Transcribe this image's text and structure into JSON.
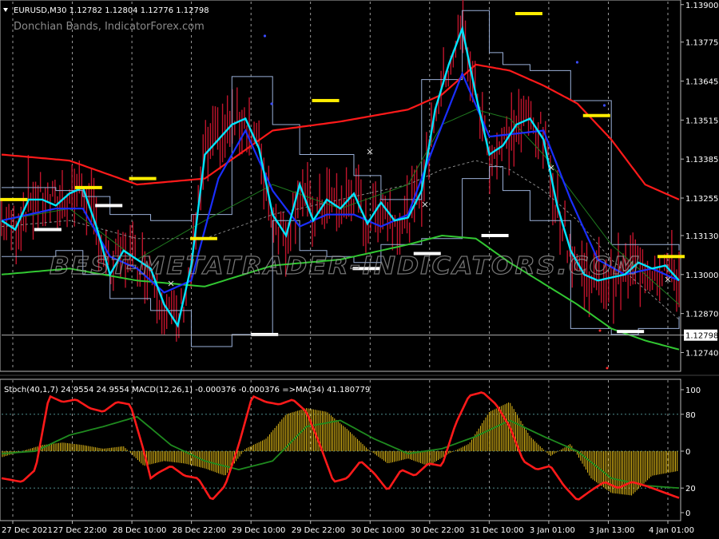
{
  "header": {
    "symbol_line": "EURUSD,M30  1.12782 1.12804 1.12776 1.12798",
    "indicator_name": "Donchian Bands, IndicatorForex.com"
  },
  "watermark": "BEST-METATRADER-INDICATORS.COM",
  "sub_header": "Stoch(40,1,7) 24.9554 24.9554  MACD(12,26,1) -0.000376 -0.000376  =>MA(34) 41.180779",
  "colors": {
    "background": "#000000",
    "candles": "#c0142c",
    "donchian": "#9ab0d8",
    "ma_red": "#ff1a1a",
    "ma_green": "#32c832",
    "ma_darkgreen": "#1f7a1f",
    "ma_gray": "#8c8c8c",
    "fast_cyan": "#00e5ff",
    "slow_blue": "#1a2fff",
    "highs": "#ffee00",
    "lows": "#ffffff",
    "stoch": "#ff1a1a",
    "signal": "#1f8a1f",
    "macd_hist": "#ffd21a",
    "price_marker": "#ffffff"
  },
  "chart_data": [
    {
      "type": "line",
      "symbol": "EURUSD",
      "timeframe": "M30",
      "x_ticks": [
        "27 Dec 2021",
        "27 Dec 22:00",
        "28 Dec 10:00",
        "28 Dec 22:00",
        "29 Dec 10:00",
        "29 Dec 22:00",
        "30 Dec 10:00",
        "30 Dec 22:00",
        "31 Dec 10:00",
        "3 Jan 01:00",
        "3 Jan 13:00",
        "4 Jan 01:00"
      ],
      "y_ticks": [
        "1.13900",
        "1.13775",
        "1.13645",
        "1.13515",
        "1.13385",
        "1.13255",
        "1.13130",
        "1.13000",
        "1.12870",
        "1.12798",
        "1.12740"
      ],
      "ylim": [
        1.1268,
        1.1391
      ],
      "current_price": "1.12798",
      "grid": "dashed vertical",
      "series": [
        {
          "key": "fast_ma",
          "t": [
            0,
            2,
            4,
            6,
            8,
            10,
            12,
            14,
            16,
            18,
            20,
            22,
            24,
            26,
            28,
            30,
            32,
            34,
            36,
            38,
            40,
            42,
            44,
            46,
            48,
            50,
            52,
            54,
            56,
            58,
            60,
            62,
            64,
            66,
            68,
            70,
            72,
            74,
            76,
            78,
            80,
            82,
            84,
            86,
            88,
            90,
            92,
            94,
            96,
            98,
            100
          ],
          "values": [
            1.1318,
            1.1315,
            1.1325,
            1.1325,
            1.1323,
            1.1327,
            1.1329,
            1.1316,
            1.13,
            1.1308,
            1.1305,
            1.1302,
            1.129,
            1.1283,
            1.1303,
            1.134,
            1.1345,
            1.135,
            1.1352,
            1.1342,
            1.132,
            1.1313,
            1.133,
            1.1318,
            1.1325,
            1.1322,
            1.1327,
            1.1317,
            1.1324,
            1.1318,
            1.1319,
            1.1328,
            1.1355,
            1.137,
            1.1382,
            1.136,
            1.134,
            1.1343,
            1.135,
            1.1352,
            1.1345,
            1.1323,
            1.1308,
            1.13,
            1.1298,
            1.1299,
            1.13,
            1.1304,
            1.1302,
            1.1303,
            1.1298
          ]
        },
        {
          "key": "slow_ma",
          "t": [
            0,
            4,
            8,
            12,
            16,
            20,
            24,
            28,
            32,
            36,
            40,
            44,
            48,
            52,
            56,
            60,
            64,
            68,
            72,
            76,
            80,
            84,
            88,
            92,
            96,
            100
          ],
          "values": [
            1.1318,
            1.132,
            1.1322,
            1.1322,
            1.1306,
            1.1302,
            1.1294,
            1.1298,
            1.1332,
            1.1348,
            1.1328,
            1.1316,
            1.132,
            1.132,
            1.1316,
            1.132,
            1.1344,
            1.1367,
            1.1346,
            1.1347,
            1.1348,
            1.1325,
            1.1305,
            1.13,
            1.1302,
            1.1298
          ]
        },
        {
          "key": "red_ma",
          "t": [
            0,
            10,
            20,
            30,
            40,
            50,
            60,
            65,
            70,
            75,
            80,
            85,
            90,
            95,
            100
          ],
          "values": [
            1.134,
            1.1338,
            1.133,
            1.1332,
            1.1348,
            1.1351,
            1.1355,
            1.136,
            1.137,
            1.1368,
            1.1363,
            1.1357,
            1.1345,
            1.133,
            1.1325
          ]
        },
        {
          "key": "gray_ma",
          "t": [
            0,
            10,
            20,
            30,
            40,
            50,
            60,
            65,
            70,
            75,
            80,
            85,
            90,
            95,
            100
          ],
          "values": [
            1.1316,
            1.1318,
            1.1312,
            1.1312,
            1.132,
            1.1325,
            1.133,
            1.1335,
            1.1338,
            1.1335,
            1.1328,
            1.1318,
            1.1305,
            1.1295,
            1.1285
          ]
        },
        {
          "key": "darkgreen_ma",
          "t": [
            0,
            10,
            20,
            30,
            40,
            50,
            60,
            65,
            70,
            75,
            80,
            85,
            90,
            95,
            100
          ],
          "values": [
            1.1318,
            1.1322,
            1.1305,
            1.1318,
            1.133,
            1.1322,
            1.133,
            1.135,
            1.1355,
            1.1352,
            1.134,
            1.1325,
            1.131,
            1.13,
            1.129
          ]
        },
        {
          "key": "green_ma",
          "t": [
            0,
            10,
            20,
            30,
            40,
            50,
            60,
            65,
            70,
            75,
            80,
            85,
            90,
            95,
            100
          ],
          "values": [
            1.13,
            1.1302,
            1.1298,
            1.1296,
            1.1303,
            1.1305,
            1.131,
            1.1313,
            1.1312,
            1.1304,
            1.1297,
            1.129,
            1.1282,
            1.1278,
            1.1275
          ]
        }
      ],
      "donchian_upper": {
        "t": [
          0,
          8,
          12,
          16,
          22,
          28,
          34,
          40,
          44,
          48,
          52,
          56,
          62,
          68,
          72,
          74,
          78,
          84,
          90,
          94,
          100
        ],
        "values": [
          1.1329,
          1.1328,
          1.1326,
          1.132,
          1.1318,
          1.132,
          1.1366,
          1.135,
          1.134,
          1.134,
          1.1333,
          1.1325,
          1.1365,
          1.1388,
          1.1374,
          1.137,
          1.1368,
          1.1358,
          1.131,
          1.131,
          1.1308
        ]
      },
      "donchian_lower": {
        "t": [
          0,
          8,
          12,
          16,
          22,
          28,
          34,
          40,
          44,
          48,
          52,
          56,
          62,
          68,
          72,
          74,
          78,
          84,
          90,
          94,
          100
        ],
        "values": [
          1.1306,
          1.1308,
          1.13,
          1.1292,
          1.1288,
          1.1276,
          1.128,
          1.1318,
          1.1308,
          1.1306,
          1.1304,
          1.131,
          1.1312,
          1.1332,
          1.1336,
          1.1328,
          1.1318,
          1.1282,
          1.128,
          1.1282,
          1.1286
        ]
      },
      "high_markers": [
        {
          "t": 1,
          "y": 1.1325
        },
        {
          "t": 12,
          "y": 1.1329
        },
        {
          "t": 20,
          "y": 1.1332
        },
        {
          "t": 29,
          "y": 1.1312
        },
        {
          "t": 47,
          "y": 1.1358
        },
        {
          "t": 77,
          "y": 1.1387
        },
        {
          "t": 87,
          "y": 1.1353
        },
        {
          "t": 98,
          "y": 1.1306
        }
      ],
      "low_markers": [
        {
          "t": 6,
          "y": 1.1315
        },
        {
          "t": 15,
          "y": 1.1323
        },
        {
          "t": 38,
          "y": 1.128
        },
        {
          "t": 53,
          "y": 1.1302
        },
        {
          "t": 62,
          "y": 1.1307
        },
        {
          "t": 72,
          "y": 1.1313
        },
        {
          "t": 92,
          "y": 1.1281
        }
      ]
    },
    {
      "type": "line",
      "title": "Stoch(40,1,7) 24.9554 24.9554  MACD(12,26,1) -0.000376 -0.000376  =>MA(34) 41.180779",
      "y_ticks": [
        "100",
        "80",
        "0",
        "20",
        "0"
      ],
      "ylim": [
        0,
        100
      ],
      "levels": [
        80,
        50,
        20
      ],
      "series": [
        {
          "key": "stoch",
          "t": [
            0,
            3,
            5,
            7,
            9,
            11,
            13,
            15,
            17,
            19,
            21,
            22,
            23,
            25,
            27,
            29,
            31,
            33,
            35,
            37,
            39,
            41,
            43,
            45,
            47,
            49,
            51,
            53,
            55,
            57,
            59,
            61,
            63,
            65,
            67,
            69,
            71,
            73,
            75,
            77,
            79,
            81,
            83,
            85,
            87,
            89,
            91,
            93,
            95,
            97,
            100
          ],
          "values": [
            28,
            25,
            35,
            95,
            90,
            92,
            85,
            82,
            90,
            88,
            50,
            28,
            32,
            38,
            30,
            28,
            10,
            22,
            55,
            95,
            90,
            88,
            92,
            82,
            55,
            25,
            28,
            42,
            32,
            18,
            35,
            30,
            40,
            38,
            72,
            95,
            98,
            88,
            70,
            42,
            35,
            38,
            22,
            10,
            18,
            25,
            20,
            25,
            22,
            18,
            12
          ]
        },
        {
          "key": "signal",
          "t": [
            0,
            5,
            10,
            15,
            20,
            25,
            30,
            35,
            40,
            45,
            50,
            55,
            60,
            65,
            70,
            75,
            80,
            85,
            90,
            95,
            100
          ],
          "values": [
            48,
            50,
            63,
            70,
            78,
            55,
            42,
            35,
            42,
            70,
            75,
            60,
            48,
            52,
            62,
            75,
            62,
            50,
            28,
            22,
            20
          ]
        },
        {
          "key": "macd_hist",
          "t": [
            0,
            3,
            6,
            9,
            12,
            15,
            18,
            21,
            24,
            27,
            30,
            33,
            36,
            39,
            42,
            45,
            48,
            51,
            54,
            57,
            60,
            63,
            66,
            69,
            72,
            75,
            78,
            81,
            84,
            87,
            90,
            93,
            96,
            100
          ],
          "values": [
            45,
            50,
            55,
            57,
            55,
            52,
            54,
            38,
            42,
            40,
            36,
            30,
            52,
            60,
            80,
            85,
            82,
            68,
            52,
            40,
            44,
            38,
            48,
            56,
            82,
            90,
            62,
            46,
            56,
            28,
            16,
            14,
            30,
            34
          ]
        }
      ]
    }
  ]
}
